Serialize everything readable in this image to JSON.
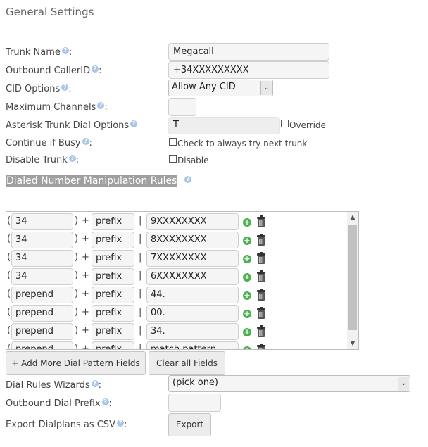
{
  "page": {
    "title": "General Settings"
  },
  "fields": {
    "trunk_name": {
      "label": "Trunk Name",
      "value": "Megacall"
    },
    "outbound_callerid": {
      "label": "Outbound CallerID",
      "value": "+34XXXXXXXXX"
    },
    "cid_options": {
      "label": "CID Options",
      "value": "Allow Any CID"
    },
    "max_channels": {
      "label": "Maximum Channels",
      "value": ""
    },
    "dial_options": {
      "label": "Asterisk Trunk Dial Options",
      "value": "T",
      "override_label": "Override"
    },
    "continue_if_busy": {
      "label": "Continue if Busy",
      "checkbox_label": "Check to always try next trunk"
    },
    "disable_trunk": {
      "label": "Disable Trunk",
      "checkbox_label": "Disable"
    }
  },
  "rules_section": {
    "title": "Dialed Number Manipulation Rules",
    "rows": [
      {
        "prepend": "34",
        "prefix": "prefix",
        "pattern": "9XXXXXXXX"
      },
      {
        "prepend": "34",
        "prefix": "prefix",
        "pattern": "8XXXXXXXX"
      },
      {
        "prepend": "34",
        "prefix": "prefix",
        "pattern": "7XXXXXXXX"
      },
      {
        "prepend": "34",
        "prefix": "prefix",
        "pattern": "6XXXXXXXX"
      },
      {
        "prepend": "prepend",
        "prefix": "prefix",
        "pattern": "44."
      },
      {
        "prepend": "prepend",
        "prefix": "prefix",
        "pattern": "00."
      },
      {
        "prepend": "prepend",
        "prefix": "prefix",
        "pattern": "34."
      },
      {
        "prepend": "prepend",
        "prefix": "prefix",
        "pattern": "match pattern"
      }
    ],
    "paren_open": "(",
    "paren_close": ")",
    "plus": "+",
    "pipe": "|"
  },
  "buttons": {
    "add_more": "+ Add More Dial Pattern Fields",
    "clear_all": "Clear all Fields"
  },
  "bottom": {
    "wizards": {
      "label": "Dial Rules Wizards",
      "value": "(pick one)"
    },
    "outbound_prefix": {
      "label": "Outbound Dial Prefix",
      "value": ""
    },
    "export": {
      "label": "Export Dialplans as CSV",
      "button": "Export"
    }
  },
  "icons": {
    "help": "help-icon",
    "add": "plus-icon",
    "delete": "trash-icon"
  },
  "colors": {
    "help": "#a9c6e8",
    "section_bg": "#a0a0a0",
    "add_icon": "#4caf50"
  }
}
